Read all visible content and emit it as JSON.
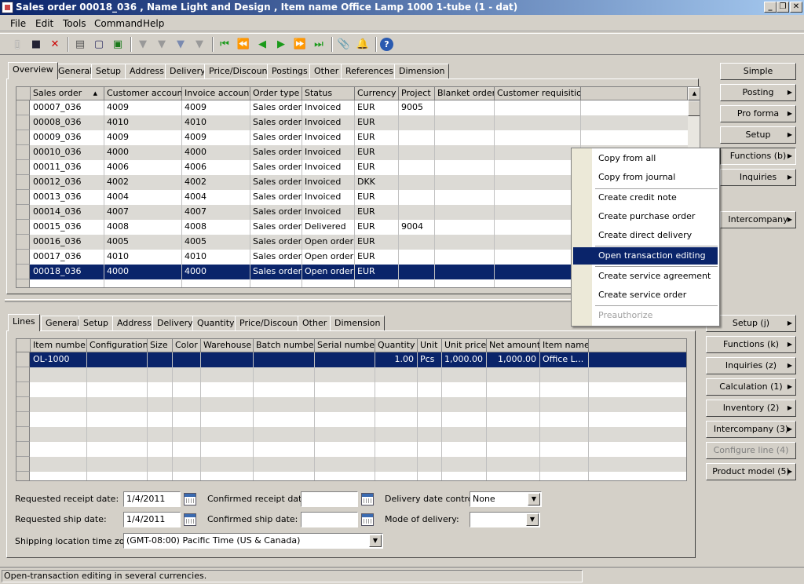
{
  "window": {
    "title": "Sales order 00018_036 , Name Light and Design , Item name Office Lamp 1000 1-tube (1 - dat)"
  },
  "menubar": [
    {
      "label": "File"
    },
    {
      "label": "Edit"
    },
    {
      "label": "Tools"
    },
    {
      "label": "Command"
    },
    {
      "label": "Help"
    }
  ],
  "toolbar": {
    "icons": [
      "new-icon",
      "save-icon",
      "delete-icon",
      "print-icon",
      "print-preview-icon",
      "export-excel-icon",
      "filter-icon",
      "filter-by-selection-icon",
      "advanced-filter-icon",
      "remove-filter-icon",
      "first-record-icon",
      "previous-page-icon",
      "previous-record-icon",
      "next-record-icon",
      "next-page-icon",
      "last-record-icon",
      "document-handling-icon",
      "alert-icon",
      "help-icon"
    ]
  },
  "header_tabs": [
    "Overview",
    "General",
    "Setup",
    "Address",
    "Delivery",
    "Price/Discount",
    "Postings",
    "Other",
    "References",
    "Dimension"
  ],
  "orders_grid": {
    "columns": [
      "Sales order",
      "Customer account",
      "Invoice account",
      "Order type",
      "Status",
      "Currency",
      "Project",
      "Blanket order",
      "Customer requisition"
    ],
    "rows": [
      [
        "00007_036",
        "4009",
        "4009",
        "Sales order",
        "Invoiced",
        "EUR",
        "9005",
        "",
        ""
      ],
      [
        "00008_036",
        "4010",
        "4010",
        "Sales order",
        "Invoiced",
        "EUR",
        "",
        "",
        ""
      ],
      [
        "00009_036",
        "4009",
        "4009",
        "Sales order",
        "Invoiced",
        "EUR",
        "",
        "",
        ""
      ],
      [
        "00010_036",
        "4000",
        "4000",
        "Sales order",
        "Invoiced",
        "EUR",
        "",
        "",
        ""
      ],
      [
        "00011_036",
        "4006",
        "4006",
        "Sales order",
        "Invoiced",
        "EUR",
        "",
        "",
        ""
      ],
      [
        "00012_036",
        "4002",
        "4002",
        "Sales order",
        "Invoiced",
        "DKK",
        "",
        "",
        ""
      ],
      [
        "00013_036",
        "4004",
        "4004",
        "Sales order",
        "Invoiced",
        "EUR",
        "",
        "",
        ""
      ],
      [
        "00014_036",
        "4007",
        "4007",
        "Sales order",
        "Invoiced",
        "EUR",
        "",
        "",
        ""
      ],
      [
        "00015_036",
        "4008",
        "4008",
        "Sales order",
        "Delivered",
        "EUR",
        "9004",
        "",
        ""
      ],
      [
        "00016_036",
        "4005",
        "4005",
        "Sales order",
        "Open order",
        "EUR",
        "",
        "",
        ""
      ],
      [
        "00017_036",
        "4010",
        "4010",
        "Sales order",
        "Open order",
        "EUR",
        "",
        "",
        ""
      ],
      [
        "00018_036",
        "4000",
        "4000",
        "Sales order",
        "Open order",
        "EUR",
        "",
        "",
        ""
      ]
    ],
    "selected_index": 11
  },
  "header_buttons": [
    {
      "label": "Simple",
      "arrow": false
    },
    {
      "label": "Posting",
      "arrow": true
    },
    {
      "label": "Pro forma",
      "arrow": true
    },
    {
      "label": "Setup",
      "arrow": true
    },
    {
      "label": "Functions (b)",
      "arrow": true
    },
    {
      "label": "Inquiries",
      "arrow": true
    },
    {
      "label": "Intercompany",
      "arrow": true
    }
  ],
  "context_menu": {
    "items": [
      {
        "label": "Copy from all",
        "state": "normal"
      },
      {
        "label": "Copy from journal",
        "state": "normal"
      },
      {
        "label": "Create credit note",
        "state": "normal"
      },
      {
        "label": "Create purchase order",
        "state": "normal"
      },
      {
        "label": "Create direct delivery",
        "state": "normal"
      },
      {
        "label": "Open transaction editing",
        "state": "selected"
      },
      {
        "label": "Create service agreement",
        "state": "normal"
      },
      {
        "label": "Create service order",
        "state": "normal"
      },
      {
        "label": "Preauthorize",
        "state": "disabled"
      }
    ]
  },
  "line_tabs": [
    "Lines",
    "General",
    "Setup",
    "Address",
    "Delivery",
    "Quantity",
    "Price/Discount",
    "Other",
    "Dimension"
  ],
  "lines_grid": {
    "columns": [
      "Item number",
      "Configuration",
      "Size",
      "Color",
      "Warehouse",
      "Batch number",
      "Serial number",
      "Quantity",
      "Unit",
      "Unit price",
      "Net amount",
      "Item name"
    ],
    "rows": [
      [
        "OL-1000",
        "",
        "",
        "",
        "",
        "",
        "",
        "1.00",
        "Pcs",
        "1,000.00",
        "1,000.00",
        "Office L..."
      ]
    ]
  },
  "line_buttons": [
    {
      "label": "Setup (j)",
      "disabled": false
    },
    {
      "label": "Functions (k)",
      "disabled": false
    },
    {
      "label": "Inquiries (z)",
      "disabled": false
    },
    {
      "label": "Calculation (1)",
      "disabled": false
    },
    {
      "label": "Inventory (2)",
      "disabled": false
    },
    {
      "label": "Intercompany (3)",
      "disabled": false
    },
    {
      "label": "Configure line (4)",
      "disabled": true
    },
    {
      "label": "Product model (5)",
      "disabled": false
    }
  ],
  "form_fields": {
    "requested_receipt_label": "Requested receipt date:",
    "requested_receipt_value": "1/4/2011",
    "confirmed_receipt_label": "Confirmed receipt date:",
    "confirmed_receipt_value": "",
    "delivery_control_label": "Delivery date control:",
    "delivery_control_value": "None",
    "requested_ship_label": "Requested ship date:",
    "requested_ship_value": "1/4/2011",
    "confirmed_ship_label": "Confirmed ship date:",
    "confirmed_ship_value": "",
    "mode_delivery_label": "Mode of delivery:",
    "mode_delivery_value": "",
    "timezone_label": "Shipping location time zone:",
    "timezone_value": "(GMT-08:00) Pacific Time (US & Canada)"
  },
  "status": {
    "text": "Open-transaction editing in several currencies."
  }
}
